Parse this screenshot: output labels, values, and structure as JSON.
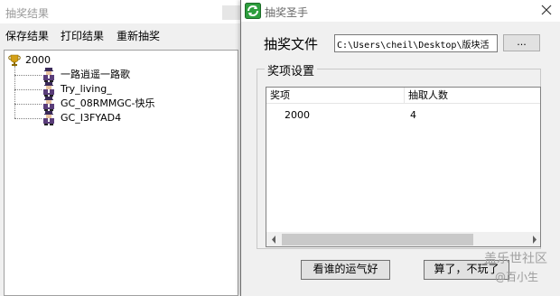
{
  "result_window": {
    "title": "抽奖结果",
    "menu": {
      "save": "保存结果",
      "print": "打印结果",
      "redraw": "重新抽奖"
    },
    "tree": {
      "root": {
        "label": "2000",
        "icon": "trophy-icon"
      },
      "children": [
        {
          "label": "一路逍遥一路歌",
          "icon": "user-icon"
        },
        {
          "label": "Try_living_",
          "icon": "user-icon"
        },
        {
          "label": "GC_08RMMGC-快乐",
          "icon": "user-icon"
        },
        {
          "label": "GC_I3FYAD4",
          "icon": "user-icon"
        }
      ]
    }
  },
  "dialog": {
    "title": "抽奖圣手",
    "file_label": "抽奖文件",
    "file_path": "C:\\Users\\cheil\\Desktop\\版块活",
    "browse_label": "...",
    "prize_group_label": "奖项设置",
    "list": {
      "columns": [
        "奖项",
        "抽取人数"
      ],
      "rows": [
        [
          "2000",
          "4"
        ]
      ]
    },
    "buttons": {
      "lucky": "看谁的运气好",
      "quit": "算了，不玩了"
    }
  },
  "watermark": {
    "title": "盖乐世社区",
    "author": "@百小生"
  },
  "colors": {
    "accent_green": "#2e9e3e",
    "trophy_gold": "#d4a017"
  }
}
